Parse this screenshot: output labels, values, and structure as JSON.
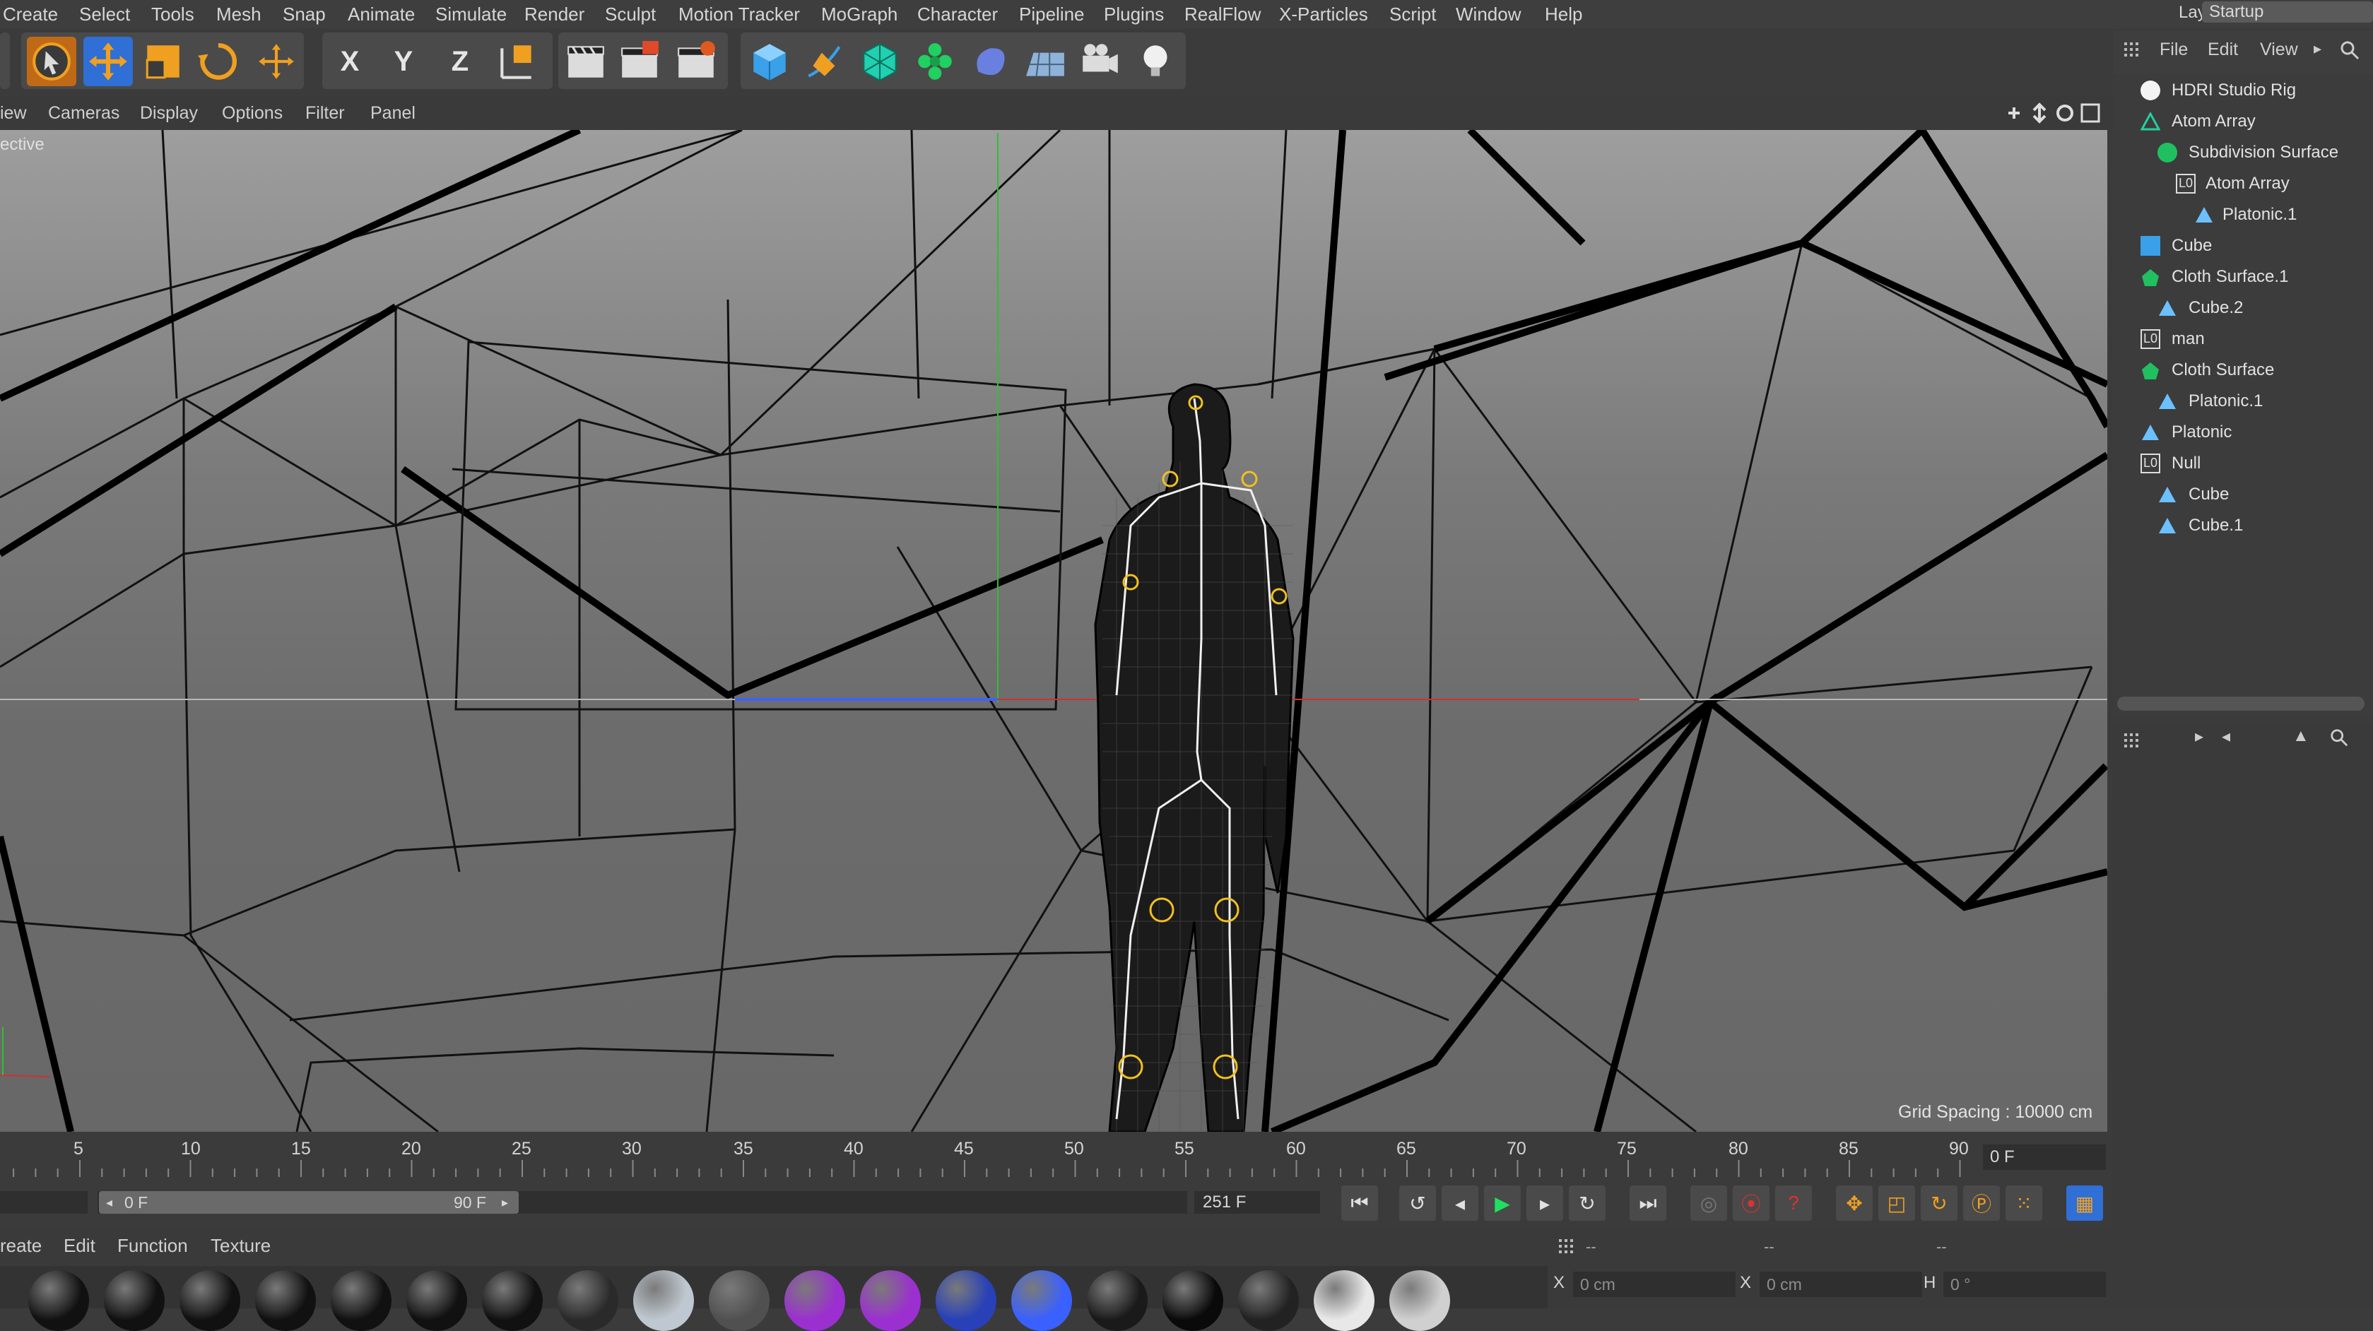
{
  "menubar": {
    "items": [
      "Create",
      "Select",
      "Tools",
      "Mesh",
      "Snap",
      "Animate",
      "Simulate",
      "Render",
      "Sculpt",
      "Motion Tracker",
      "MoGraph",
      "Character",
      "Pipeline",
      "Plugins",
      "RealFlow",
      "X-Particles",
      "Script",
      "Window",
      "Help"
    ],
    "layout_label": "Layout:",
    "layout_value": "Startup"
  },
  "toolbar": {
    "axis_x": "X",
    "axis_y": "Y",
    "axis_z": "Z"
  },
  "viewport": {
    "menu": [
      "iew",
      "Cameras",
      "Display",
      "Options",
      "Filter",
      "Panel"
    ],
    "camera_label": "ective",
    "grid_spacing": "Grid Spacing : 10000 cm"
  },
  "object_manager": {
    "menu": [
      "File",
      "Edit",
      "View"
    ],
    "objects": [
      {
        "name": "HDRI Studio Rig",
        "icon": "sphere-icon"
      },
      {
        "name": "Atom Array",
        "icon": "atom-array-icon"
      },
      {
        "name": "Subdivision Surface",
        "icon": "subdivision-icon"
      },
      {
        "name": "Atom Array",
        "icon": "null-icon"
      },
      {
        "name": "Platonic.1",
        "icon": "platonic-icon"
      },
      {
        "name": "Cube",
        "icon": "cube-icon"
      },
      {
        "name": "Cloth Surface.1",
        "icon": "cloth-icon"
      },
      {
        "name": "Cube.2",
        "icon": "platonic-icon"
      },
      {
        "name": "man",
        "icon": "null-icon"
      },
      {
        "name": "Cloth Surface",
        "icon": "cloth-icon"
      },
      {
        "name": "Platonic.1",
        "icon": "platonic-icon"
      },
      {
        "name": "Platonic",
        "icon": "platonic-icon"
      },
      {
        "name": "Null",
        "icon": "null-icon"
      },
      {
        "name": "Cube",
        "icon": "platonic-icon"
      },
      {
        "name": "Cube.1",
        "icon": "platonic-icon"
      }
    ]
  },
  "timeline": {
    "ticks": [
      "5",
      "10",
      "15",
      "20",
      "25",
      "30",
      "35",
      "40",
      "45",
      "50",
      "55",
      "60",
      "65",
      "70",
      "75",
      "80",
      "85",
      "90"
    ],
    "current_frame": "0 F",
    "range_start": "0 F",
    "range_end": "90 F",
    "end_frame": "251 F"
  },
  "materials": {
    "menu": [
      "reate",
      "Edit",
      "Function",
      "Texture"
    ],
    "swatch_colors": [
      "#111111",
      "#111111",
      "#111111",
      "#111111",
      "#111111",
      "#111111",
      "#111111",
      "#2a2a2a",
      "#bfc8d0",
      "#505050",
      "#9b2fd0",
      "#9b2fd0",
      "#2840b8",
      "#3a60ff",
      "#1a1a1a",
      "#0a0a0a",
      "#222222",
      "#e8e8e8",
      "#d0d0d0"
    ]
  },
  "coordinates": {
    "headers": [
      "--",
      "--",
      "--"
    ],
    "x_label": "X",
    "x_value": "0 cm",
    "x2_label": "X",
    "x2_value": "0 cm",
    "h_label": "H",
    "h_value": "0 °"
  },
  "colors": {
    "accent_blue": "#2f6fd6",
    "orange": "#f0a020",
    "teal": "#20d0b0"
  }
}
